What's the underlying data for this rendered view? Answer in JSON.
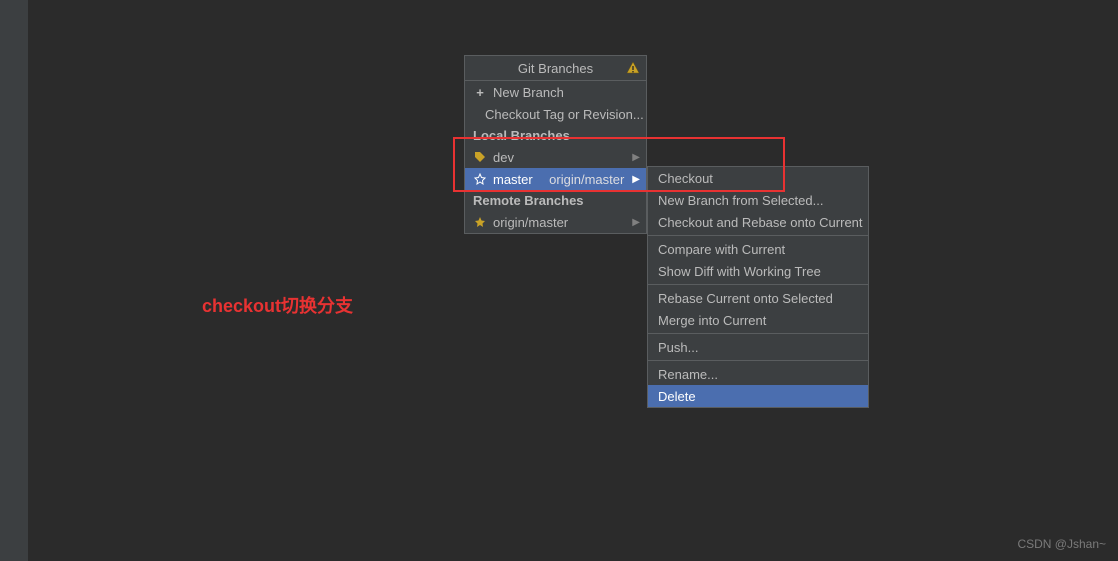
{
  "popup": {
    "title": "Git Branches",
    "new_branch": "New Branch",
    "checkout_tag": "Checkout Tag or Revision...",
    "local_header": "Local Branches",
    "local": [
      {
        "name": "dev",
        "tracking": ""
      },
      {
        "name": "master",
        "tracking": "origin/master"
      }
    ],
    "remote_header": "Remote Branches",
    "remote": [
      {
        "name": "origin/master"
      }
    ]
  },
  "submenu": {
    "checkout": "Checkout",
    "new_branch": "New Branch from Selected...",
    "checkout_rebase": "Checkout and Rebase onto Current",
    "compare": "Compare with Current",
    "show_diff": "Show Diff with Working Tree",
    "rebase": "Rebase Current onto Selected",
    "merge": "Merge into Current",
    "push": "Push...",
    "rename": "Rename...",
    "delete": "Delete"
  },
  "annotation": "checkout切换分支",
  "watermark": "CSDN @Jshan~"
}
